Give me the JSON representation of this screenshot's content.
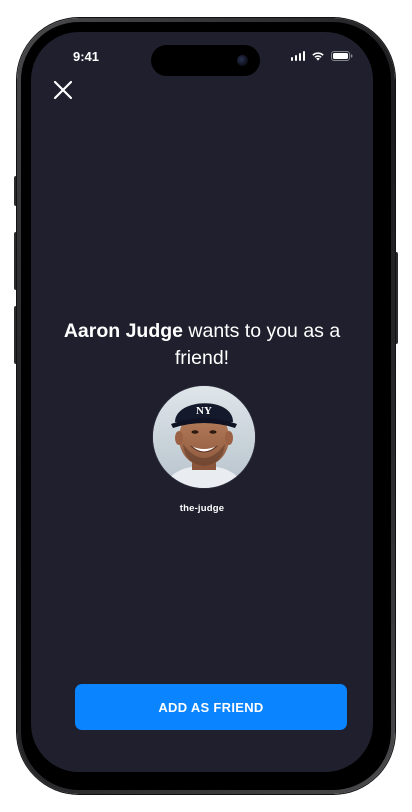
{
  "status_bar": {
    "time": "9:41",
    "signal_icon": "cellular-signal-icon",
    "wifi_icon": "wifi-icon",
    "battery_icon": "battery-icon"
  },
  "header": {
    "close_icon": "close-icon"
  },
  "invite": {
    "sender_name": "Aaron Judge",
    "message_rest": " wants to you as a friend!"
  },
  "profile": {
    "username": "the-judge",
    "avatar_cap_logo": "NY"
  },
  "actions": {
    "add_friend_label": "ADD AS FRIEND"
  },
  "colors": {
    "screen_background": "#1f1f2d",
    "primary_button": "#0a84ff",
    "text": "#ffffff"
  }
}
